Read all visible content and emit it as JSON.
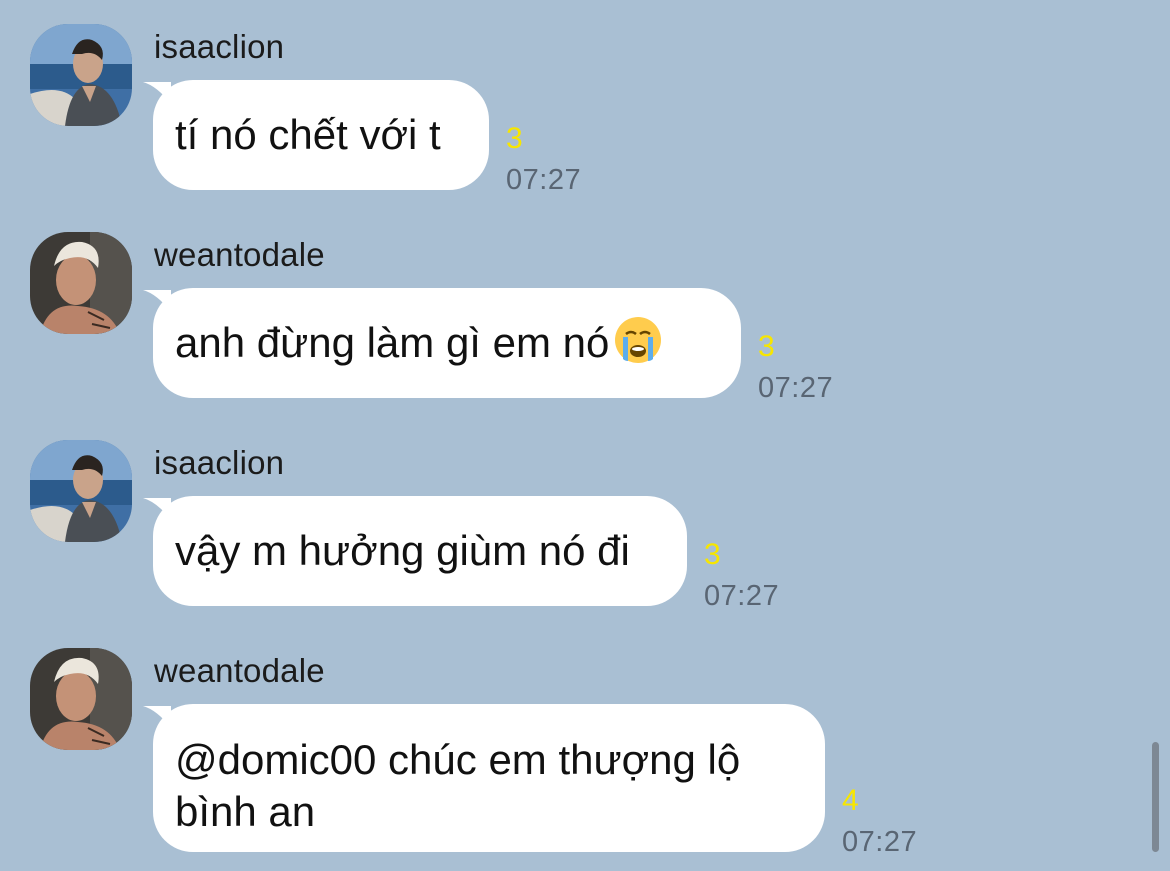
{
  "chat": {
    "messages": [
      {
        "sender": "isaaclion",
        "text": "tí nó chết với t",
        "read_count": "3",
        "time": "07:27"
      },
      {
        "sender": "weantodale",
        "text": "anh đừng làm gì em nó",
        "emoji": "loudly-crying-face",
        "read_count": "3",
        "time": "07:27"
      },
      {
        "sender": "isaaclion",
        "text": "vậy m hưởng giùm nó đi",
        "read_count": "3",
        "time": "07:27"
      },
      {
        "sender": "weantodale",
        "text_line1": "@domic00 chúc em thượng lộ",
        "text_line2": "bình an",
        "read_count": "4",
        "time": "07:27"
      }
    ]
  },
  "colors": {
    "background": "#a9bfd3",
    "bubble": "#ffffff",
    "read_count": "#f7e600",
    "time": "#596573"
  }
}
